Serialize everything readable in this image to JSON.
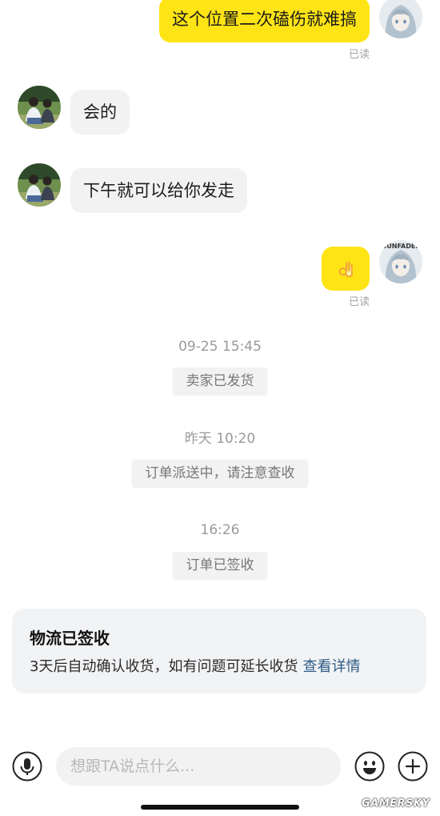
{
  "watermark": "GAMERSKY",
  "colors": {
    "outgoing_bubble": "#ffe415",
    "incoming_bubble": "#f2f2f2",
    "notice_bg": "#f2f2f2",
    "link": "#2e5a86",
    "text": "#1c1c1c"
  },
  "avatars": {
    "self_lettering": "SUNFADEL"
  },
  "chat": {
    "messages": [
      {
        "text": "这个位置二次磕伤就难搞",
        "status": "已读"
      },
      {
        "text": "会的"
      },
      {
        "text": "下午就可以给你发走"
      },
      {
        "emoji_icon": "ok-hand-emoji",
        "status": "已读"
      }
    ],
    "events": [
      {
        "time": "09-25 15:45",
        "notice": "卖家已发货"
      },
      {
        "time": "昨天 10:20",
        "notice": "订单派送中，请注意查收"
      },
      {
        "time": "16:26",
        "notice": "订单已签收"
      }
    ]
  },
  "logistics_card": {
    "title": "物流已签收",
    "body": "3天后自动确认收货，如有问题可延长收货",
    "link": "查看详情"
  },
  "input_bar": {
    "placeholder": "想跟TA说点什么...",
    "icons": [
      "mic-icon",
      "emoji-icon",
      "plus-icon"
    ]
  }
}
